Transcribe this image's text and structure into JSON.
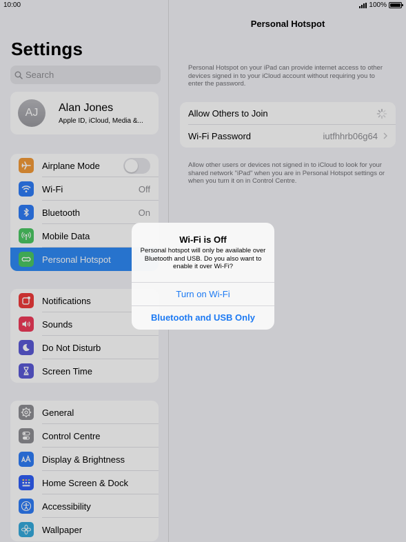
{
  "status": {
    "time": "10:00",
    "battery": "100%"
  },
  "sidebar": {
    "title": "Settings",
    "search_placeholder": "Search",
    "profile": {
      "initials": "AJ",
      "name": "Alan Jones",
      "subtitle": "Apple ID, iCloud, Media &..."
    },
    "group1": [
      {
        "label": "Airplane Mode",
        "icon": "airplane-icon",
        "color": "#f29a38"
      },
      {
        "label": "Wi-Fi",
        "icon": "wifi-icon",
        "color": "#2f7cf6",
        "value": "Off"
      },
      {
        "label": "Bluetooth",
        "icon": "bluetooth-icon",
        "color": "#2f7cf6",
        "value": "On"
      },
      {
        "label": "Mobile Data",
        "icon": "antenna-icon",
        "color": "#4cc764"
      },
      {
        "label": "Personal Hotspot",
        "icon": "hotspot-icon",
        "color": "#4cc764"
      }
    ],
    "group2": [
      {
        "label": "Notifications",
        "icon": "notifications-icon",
        "color": "#ef3b3b"
      },
      {
        "label": "Sounds",
        "icon": "speaker-icon",
        "color": "#ef3b5a"
      },
      {
        "label": "Do Not Disturb",
        "icon": "moon-icon",
        "color": "#5b5ad6"
      },
      {
        "label": "Screen Time",
        "icon": "hourglass-icon",
        "color": "#5b5ad6"
      }
    ],
    "group3": [
      {
        "label": "General",
        "icon": "gear-icon",
        "color": "#8e8e93"
      },
      {
        "label": "Control Centre",
        "icon": "toggles-icon",
        "color": "#8e8e93"
      },
      {
        "label": "Display & Brightness",
        "icon": "text-size-icon",
        "color": "#2f7cf6"
      },
      {
        "label": "Home Screen & Dock",
        "icon": "grid-icon",
        "color": "#2f5ff6"
      },
      {
        "label": "Accessibility",
        "icon": "accessibility-icon",
        "color": "#2f7cf6"
      },
      {
        "label": "Wallpaper",
        "icon": "flower-icon",
        "color": "#35aadc"
      }
    ]
  },
  "detail": {
    "title": "Personal Hotspot",
    "top_note": "Personal Hotspot on your iPad can provide internet access to other devices signed in to your iCloud account without requiring you to enter the password.",
    "allow_label": "Allow Others to Join",
    "password_label": "Wi-Fi Password",
    "password_value": "iutfhhrb06g64",
    "bottom_note": "Allow other users or devices not signed in to iCloud to look for your shared network \"iPad\" when you are in Personal Hotspot settings or when you turn it on in Control Centre."
  },
  "alert": {
    "title": "Wi-Fi is Off",
    "message": "Personal hotspot will only be available over Bluetooth and USB. Do you also want to enable it over Wi-Fi?",
    "button_primary": "Turn on Wi-Fi",
    "button_secondary": "Bluetooth and USB Only"
  },
  "colors": {
    "accent": "#1d7af3",
    "selected": "#2f8af5"
  }
}
